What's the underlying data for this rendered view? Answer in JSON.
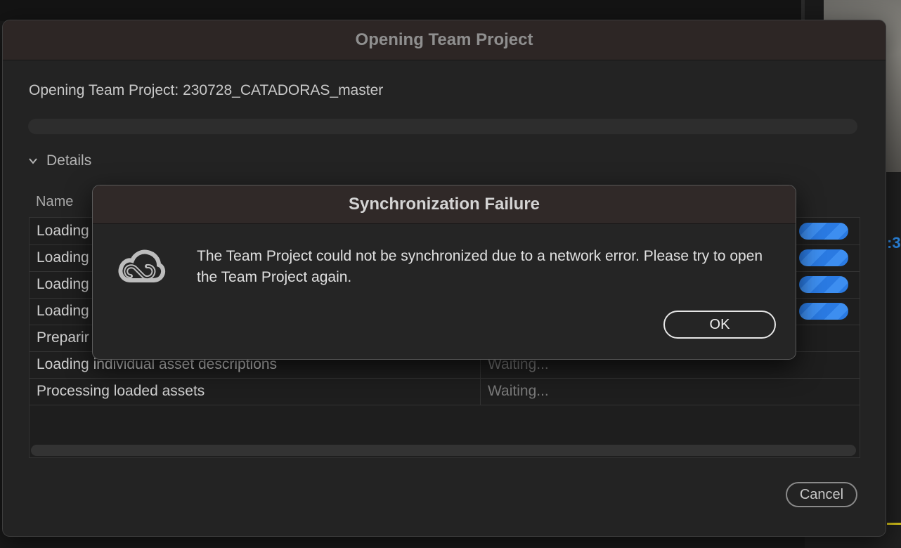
{
  "background": {
    "timecode_fragment": ":3"
  },
  "dialog": {
    "title": "Opening Team Project",
    "opening_line": "Opening Team Project: 230728_CATADORAS_master",
    "details_label": "Details",
    "table": {
      "column_name": "Name",
      "rows": [
        {
          "name": "Loading",
          "status": "",
          "progress": 1.0
        },
        {
          "name": "Loading",
          "status": "",
          "progress": 1.0
        },
        {
          "name": "Loading",
          "status": "",
          "progress": 1.0
        },
        {
          "name": "Loading",
          "status": "",
          "progress": 1.0
        },
        {
          "name": "Preparir",
          "status": ""
        },
        {
          "name": "Loading individual asset descriptions",
          "status": "Waiting..."
        },
        {
          "name": "Processing loaded assets",
          "status": "Waiting..."
        }
      ]
    },
    "cancel_label": "Cancel"
  },
  "alert": {
    "title": "Synchronization Failure",
    "icon": "creative-cloud-icon",
    "message": "The Team Project could not be synchronized due to a network error. Please try to open the Team Project again.",
    "ok_label": "OK"
  },
  "colors": {
    "accent_blue": "#2a7ae2",
    "dialog_bg": "#232323",
    "titlebar_bg": "#2d2625"
  }
}
